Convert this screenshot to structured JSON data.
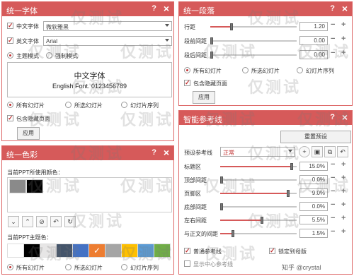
{
  "font_panel": {
    "title": "统一字体",
    "cn_font_label": "中文字体",
    "cn_font_value": "微软雅黑",
    "en_font_label": "英文字体",
    "en_font_value": "Arial",
    "mode_theme_label": "主题模式",
    "mode_force_label": "强制模式",
    "preview_cn": "中文字体",
    "preview_en": "English Font. 0123456789",
    "scope_all": "所有幻灯片",
    "scope_selected": "所选幻灯片",
    "scope_sequence": "幻灯片序列",
    "include_hidden": "包含隐藏页面",
    "apply": "应用"
  },
  "para_panel": {
    "title": "统一段落",
    "row_line": "行距",
    "row_before": "段前间距",
    "row_after": "段后间距",
    "line_value": "1.20",
    "before_value": "0.00",
    "after_value": "0.00",
    "scope_all": "所有幻灯片",
    "scope_selected": "所选幻灯片",
    "scope_sequence": "幻灯片序列",
    "include_hidden": "包含隐藏页面",
    "apply": "应用"
  },
  "color_panel": {
    "title": "统一色彩",
    "current_colors_label": "当前PPT所使用颜色：",
    "theme_colors_label": "当前PPT主题色：",
    "scope_all": "所有幻灯片",
    "scope_selected": "所选幻灯片",
    "scope_sequence": "幻灯片序列",
    "used_colors": [
      "#8a8a8a",
      "#000000"
    ],
    "theme_colors": [
      "#ffffff",
      "#000000",
      "#e7e6e6",
      "#44546a",
      "#4472c4",
      "#ed7d31",
      "#a5a5a5",
      "#ffc000",
      "#5b9bd5",
      "#70ad47"
    ],
    "checked_color": "#ed7d31"
  },
  "guide_panel": {
    "title": "智能参考线",
    "reset_button": "重置预设",
    "preset_label": "预设参考线",
    "preset_value": "正常",
    "rows": [
      {
        "label": "标题区",
        "value": "15.0%",
        "fill": 0.95
      },
      {
        "label": "顶部间距",
        "value": "0.0%",
        "fill": 0.0
      },
      {
        "label": "页脚区",
        "value": "9.0%",
        "fill": 0.9
      },
      {
        "label": "底部间距",
        "value": "0.0%",
        "fill": 0.0
      },
      {
        "label": "左右间距",
        "value": "5.5%",
        "fill": 0.55
      },
      {
        "label": "与正文的间距",
        "value": "1.5%",
        "fill": 0.15
      }
    ],
    "normal_guides": "普通参考线",
    "lock_master": "锁定到母版",
    "show_center": "显示中心参考线"
  },
  "watermark": "仅测试",
  "credit": "知乎 @crystal"
}
